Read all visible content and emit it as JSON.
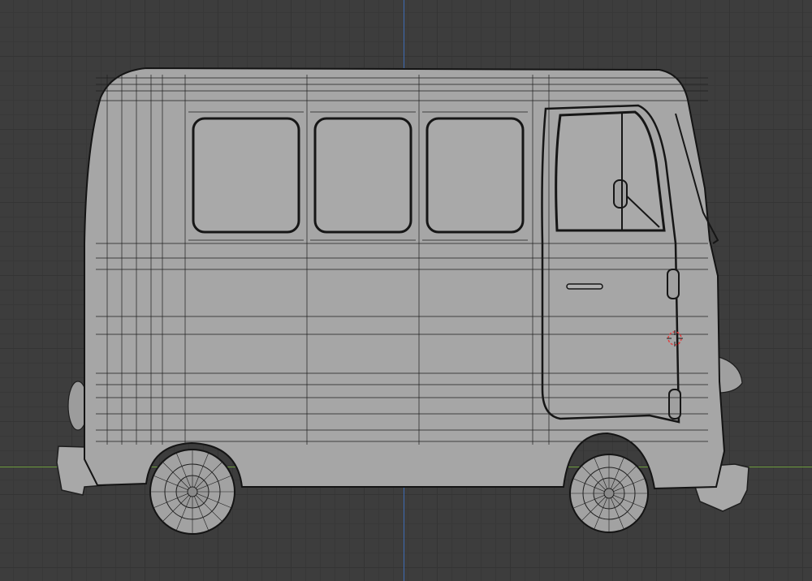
{
  "viewport": {
    "mode": "orthographic-side-view",
    "overlay": "wireframe",
    "background_color": "#3d3d3d",
    "grid_color": "#343434",
    "axis_x_color": "#6a9a3a",
    "axis_z_color": "#3e6bb3"
  },
  "model": {
    "name": "",
    "body_color": "#a6a6a6",
    "wire_color": "#1e1e1e"
  },
  "cursor": {
    "icon": "3d-cursor-icon",
    "color": "#e04040"
  }
}
